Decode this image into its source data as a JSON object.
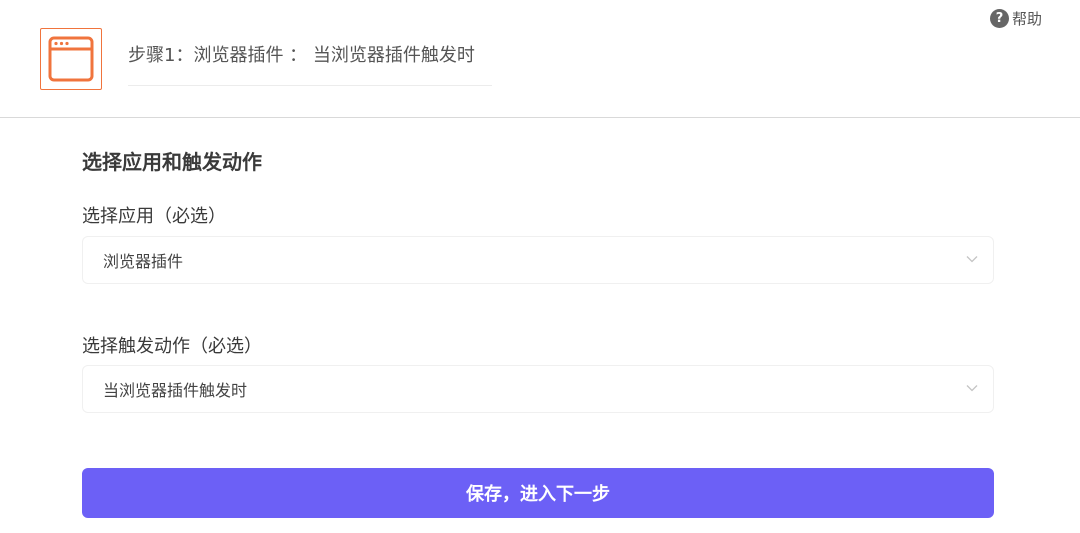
{
  "header": {
    "app_icon": "browser-window-icon",
    "step_title": "步骤1：浏览器插件 ： 当浏览器插件触发时",
    "help": {
      "icon": "question-circle-icon",
      "icon_glyph": "?",
      "label": "帮助"
    }
  },
  "main": {
    "section_title": "选择应用和触发动作",
    "app_field": {
      "label": "选择应用（必选）",
      "value": "浏览器插件",
      "icon": "chevron-down-icon"
    },
    "trigger_field": {
      "label": "选择触发动作（必选）",
      "value": "当浏览器插件触发时",
      "icon": "chevron-down-icon"
    },
    "save_button": "保存，进入下一步"
  },
  "colors": {
    "accent": "#6c60f6",
    "icon_orange": "#f0743d",
    "header_border": "#d9d9d9"
  }
}
